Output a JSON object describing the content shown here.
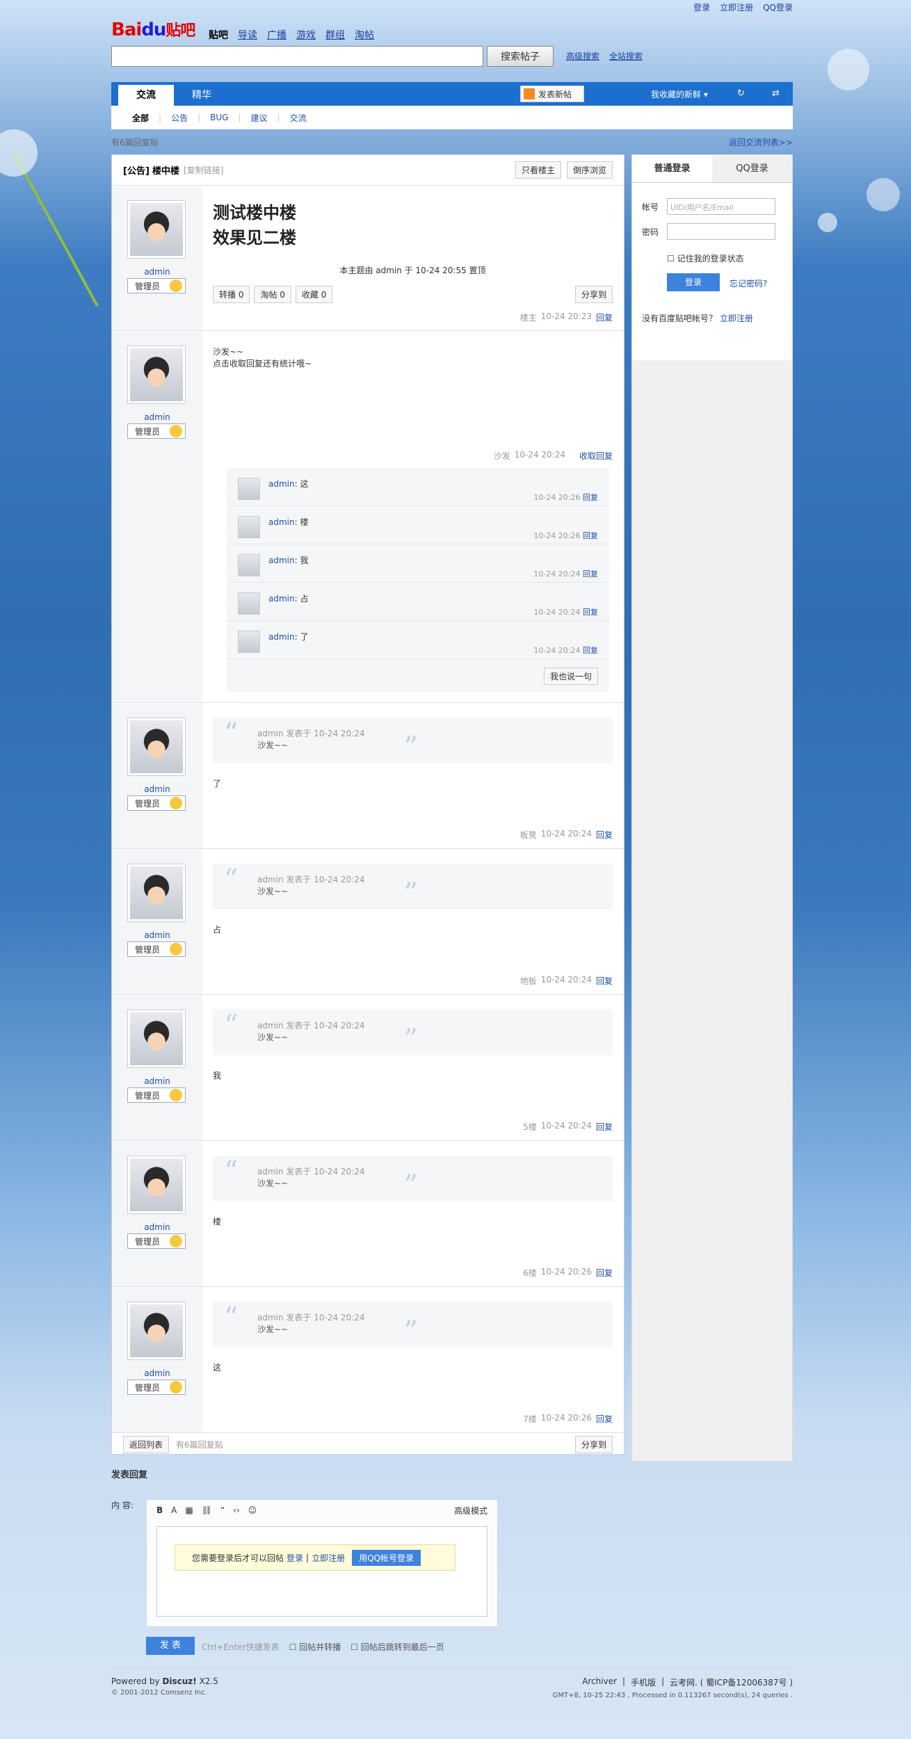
{
  "topbar": {
    "login": "登录",
    "register": "立即注册",
    "qq_login": "QQ登录"
  },
  "logo": {
    "bai": "Bai",
    "du": "du",
    "tieba": "贴吧"
  },
  "nav": [
    {
      "label": "贴吧",
      "current": true
    },
    {
      "label": "导读"
    },
    {
      "label": "广播"
    },
    {
      "label": "游戏"
    },
    {
      "label": "群组"
    },
    {
      "label": "淘帖"
    }
  ],
  "search": {
    "button": "搜索帖子",
    "advanced": "高级搜索",
    "site": "全站搜索"
  },
  "forum_tabs": {
    "tab1": "交流",
    "tab2": "精华",
    "post_new": "发表新帖",
    "favorites": "我收藏的新鲜 ▾"
  },
  "subnav": [
    {
      "label": "全部"
    },
    {
      "label": "公告"
    },
    {
      "label": "BUG"
    },
    {
      "label": "建议"
    },
    {
      "label": "交流"
    }
  ],
  "crumbs": {
    "left": "有6篇回复贴",
    "right": "返回交流列表>>"
  },
  "thread": {
    "head_tag": "[公告]",
    "head_title": "楼中楼",
    "copy_link": "[复制链接]",
    "only_host": "只看楼主",
    "reverse": "倒序浏览",
    "title_line1": "测试楼中楼",
    "title_line2": "效果见二楼",
    "topped_note": "本主题由 admin 于 10-24 20:55 置顶",
    "forward": "转播 0",
    "tao": "淘帖 0",
    "collect": "收藏 0",
    "share": "分享到",
    "floor1_meta": "楼主",
    "floor1_time": "10-24 20:23",
    "reply": "回复"
  },
  "user": {
    "name": "admin",
    "role": "管理员"
  },
  "floor2": {
    "text1": "沙发~~",
    "text2": "点击收取回复还有统计哦~",
    "meta": "沙发",
    "time": "10-24 20:24",
    "collapse": "收取回复",
    "subs": [
      {
        "text": "这",
        "time": "10-24 20:26"
      },
      {
        "text": "楼",
        "time": "10-24 20:26"
      },
      {
        "text": "我",
        "time": "10-24 20:24"
      },
      {
        "text": "占",
        "time": "10-24 20:24"
      },
      {
        "text": "了",
        "time": "10-24 20:24"
      }
    ],
    "say": "我也说一句"
  },
  "quote": {
    "author_prefix": "admin 发表于 10-24 20:24",
    "quote_text": "沙发~~"
  },
  "floors": [
    {
      "text": "了",
      "label": "板凳",
      "time": "10-24 20:24"
    },
    {
      "text": "占",
      "label": "地板",
      "time": "10-24 20:24"
    },
    {
      "text": "我",
      "label": "5楼",
      "time": "10-24 20:24"
    },
    {
      "text": "楼",
      "label": "6楼",
      "time": "10-24 20:26"
    },
    {
      "text": "这",
      "label": "7楼",
      "time": "10-24 20:26"
    }
  ],
  "thread_foot": {
    "back": "返回列表",
    "count": "有6篇回复贴"
  },
  "sidebar": {
    "tab_normal": "普通登录",
    "tab_qq": "QQ登录",
    "account_label": "帐号",
    "account_placeholder": "UID/用户名/Email",
    "password_label": "密码",
    "remember": "记住我的登录状态",
    "login": "登录",
    "forgot": "忘记密码?",
    "noacc": "没有百度贴吧帐号？",
    "register": "立即注册"
  },
  "reply": {
    "title": "发表回复",
    "content_label": "内   容:",
    "advanced": "高级模式",
    "notice": "您需要登录后才可以回帖",
    "login": "登录",
    "register": "立即注册",
    "qq": "用QQ帐号登录",
    "send": "发 表",
    "hint": "Ctrl+Enter快捷发表",
    "opt1": "回帖并转播",
    "opt2": "回帖后跳转到最后一页"
  },
  "footer": {
    "powered": "Powered by",
    "discuz": "Discuz!",
    "ver": "X2.5",
    "copy": "© 2001-2012 Comsenz Inc.",
    "archiver": "Archiver",
    "mobile": "手机版",
    "icp": "云考网. ( 蜀ICP备12006387号 )",
    "stats": "GMT+8, 10-25 22:43 , Processed in 0.113267 second(s), 24 queries ."
  }
}
